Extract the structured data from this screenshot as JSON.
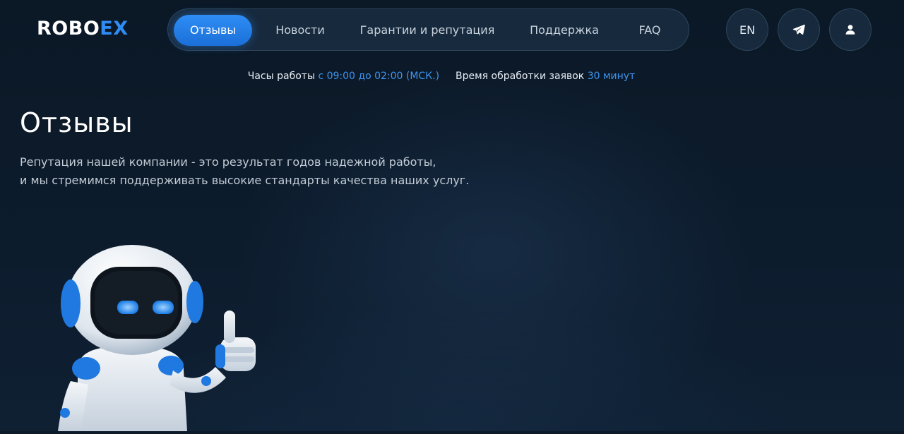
{
  "logo": {
    "part1": "ROBO",
    "part2": "EX"
  },
  "nav": {
    "items": [
      {
        "label": "Отзывы",
        "active": true
      },
      {
        "label": "Новости"
      },
      {
        "label": "Гарантии и репутация"
      },
      {
        "label": "Поддержка"
      },
      {
        "label": "FAQ"
      }
    ]
  },
  "actions": {
    "lang_label": "EN",
    "telegram_icon": "telegram-icon",
    "user_icon": "user-icon"
  },
  "info": {
    "hours_label": "Часы работы",
    "hours_value": "с 09:00 до 02:00 (МСК.)",
    "processing_label": "Время обработки заявок",
    "processing_value": "30 минут"
  },
  "page": {
    "title": "Отзывы",
    "subtitle_line1": "Репутация нашей компании - это результат годов надежной работы,",
    "subtitle_line2": "и мы стремимся поддерживать высокие стандарты качества наших услуг."
  },
  "colors": {
    "accent": "#2f8cf2",
    "background": "#0c1a2a",
    "text_muted": "#c3ccd6"
  }
}
